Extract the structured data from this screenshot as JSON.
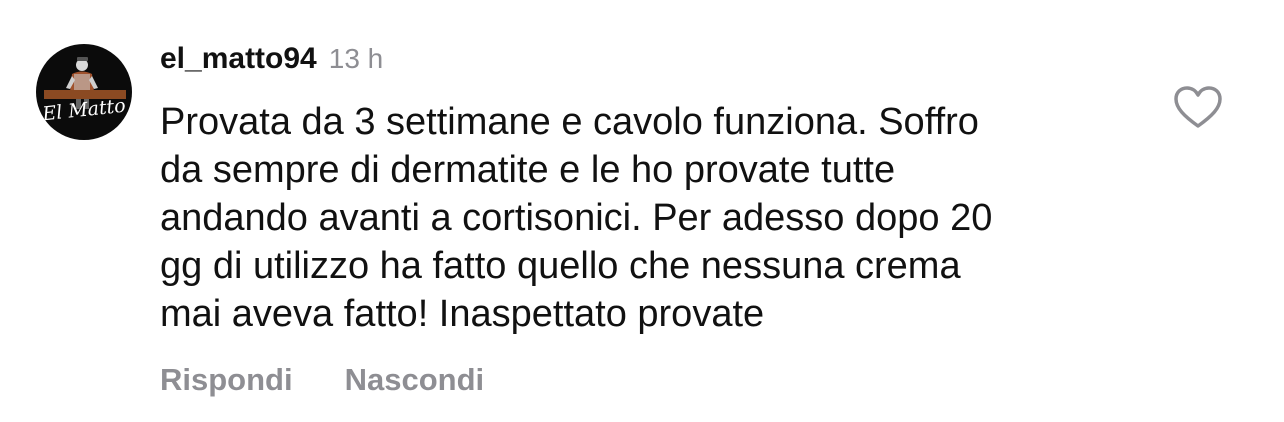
{
  "comment": {
    "username": "el_matto94",
    "time": "13 h",
    "text": "Provata da 3 settimane e cavolo funziona. Soffro\nda sempre di dermatite e le ho provate tutte\nandando avanti a cortisonici. Per adesso dopo 20\ngg di utilizzo ha fatto quello che nessuna crema\nmai aveva fatto! Inaspettato provate",
    "avatar_logo_text": "El Matto",
    "actions": {
      "reply": "Rispondi",
      "hide": "Nascondi"
    },
    "like_icon": "heart-outline-icon"
  },
  "colors": {
    "text": "#111111",
    "muted": "#8e8e93",
    "background": "#ffffff",
    "avatar_bg": "#0b0b0b"
  }
}
